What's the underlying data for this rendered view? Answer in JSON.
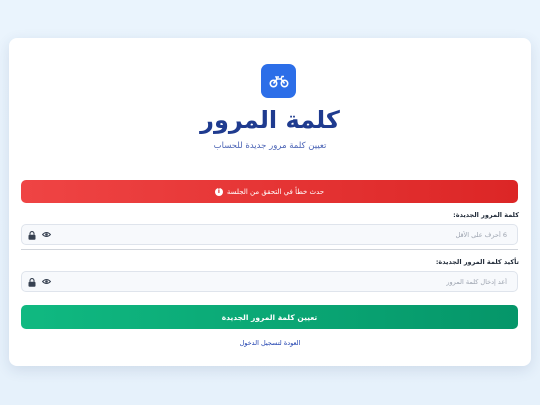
{
  "header": {
    "title": "كلمة المرور",
    "subtitle": "تعيين كلمة مرور جديدة للحساب"
  },
  "alert": {
    "message": "حدث خطأ في التحقق من الجلسة",
    "color": "#dc2626"
  },
  "form": {
    "new_password": {
      "label": "كلمة المرور الجديدة:",
      "placeholder": "6 أحرف على الأقل",
      "value": ""
    },
    "confirm_password": {
      "label": "تأكيد كلمة المرور الجديدة:",
      "placeholder": "أعد إدخال كلمة المرور",
      "value": ""
    },
    "submit_label": "تعيين كلمة المرور الجديدة"
  },
  "footer": {
    "back_link": "العودة لتسجيل الدخول"
  },
  "icons": {
    "logo": "motorcycle-icon",
    "alert": "info-icon",
    "field_left": "lock-icon",
    "field_toggle": "eye-icon"
  },
  "colors": {
    "brand": "#2c6ee8",
    "title": "#1f3b8f",
    "success": "#10b981",
    "error": "#ef4444"
  }
}
